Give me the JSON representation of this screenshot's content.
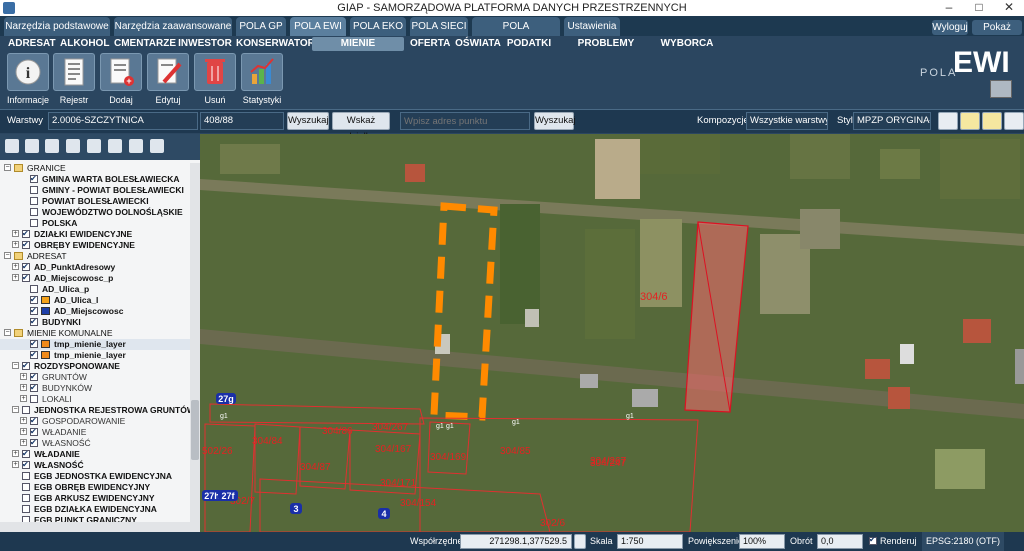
{
  "window": {
    "title": "GIAP - SAMORZĄDOWA PLATFORMA DANYCH PRZESTRZENNYCH",
    "minimize": "–",
    "maximize": "□",
    "close": "✕"
  },
  "tabs1": [
    "Narzędzia podstawowe",
    "Narzędzia zaawansowane",
    "POLA GP",
    "POLA EWI",
    "POLA EKO",
    "POLA SIECI",
    "POLA INTEGRACJE",
    "Ustawienia"
  ],
  "top_right": {
    "logout": "Wyloguj",
    "show_more": "Pokaż mniej"
  },
  "tabs2": [
    "ADRESAT",
    "ALKOHOL",
    "CMENTARZE",
    "INWESTOR",
    "KONSERWATOR",
    "MIENIE KOMUNALNE",
    "OFERTA",
    "OŚWIATA",
    "PODATKI",
    "PROBLEMY SPOŁECZNE",
    "WYBORCA"
  ],
  "ribbon": [
    "Informacje",
    "Rejestr",
    "Dodaj",
    "Edytuj",
    "Usuń",
    "Statystyki"
  ],
  "logo": {
    "pola": "POLA",
    "ewi": "EWI"
  },
  "toolbar": {
    "layers_label": "Warstwy",
    "obreb": "2.0006-SZCZYTNICA",
    "dzialka": "408/88",
    "search1": "Wyszukaj",
    "show_parcel": "Wskaż działkę",
    "addr_placeholder": "Wpisz adres punktu",
    "search2": "Wyszukaj",
    "comp_label": "Kompozycje:",
    "comp_value": "Wszystkie warstwy",
    "style_label": "Styl:",
    "style_value": "MPZP ORYGINAŁ"
  },
  "tree": [
    {
      "label": "GRANICE",
      "lvl": 0,
      "exp": "−",
      "bold": false
    },
    {
      "label": "GMINA WARTA BOLESŁAWIECKA",
      "lvl": 2,
      "chk": true,
      "bold": true
    },
    {
      "label": "GMINY - POWIAT BOLESŁAWIECKI",
      "lvl": 2,
      "chk": false,
      "bold": true
    },
    {
      "label": "POWIAT BOLESŁAWIECKI",
      "lvl": 2,
      "chk": false,
      "bold": true
    },
    {
      "label": "WOJEWÓDZTWO DOLNOŚLĄSKIE",
      "lvl": 2,
      "chk": false,
      "bold": true
    },
    {
      "label": "POLSKA",
      "lvl": 2,
      "chk": false,
      "bold": true
    },
    {
      "label": "DZIAŁKI EWIDENCYJNE",
      "lvl": 1,
      "chk": true,
      "bold": true,
      "exp": "+"
    },
    {
      "label": "OBRĘBY EWIDENCYJNE",
      "lvl": 1,
      "chk": true,
      "bold": true,
      "exp": "+"
    },
    {
      "label": "ADRESAT",
      "lvl": 0,
      "exp": "−",
      "bold": false
    },
    {
      "label": "AD_PunktAdresowy",
      "lvl": 1,
      "chk": true,
      "bold": true,
      "exp": "+"
    },
    {
      "label": "AD_Miejscowosc_p",
      "lvl": 1,
      "chk": true,
      "bold": true,
      "exp": "+"
    },
    {
      "label": "AD_Ulica_p",
      "lvl": 2,
      "chk": false,
      "bold": true
    },
    {
      "label": "AD_Ulica_l",
      "lvl": 2,
      "chk": true,
      "bold": true,
      "swatch": "#f4a21a"
    },
    {
      "label": "AD_Miejscowosc",
      "lvl": 2,
      "chk": true,
      "bold": true,
      "swatch": "#1e3fa8"
    },
    {
      "label": "BUDYNKI",
      "lvl": 2,
      "chk": true,
      "bold": true
    },
    {
      "label": "MIENIE KOMUNALNE",
      "lvl": 0,
      "exp": "−",
      "bold": false
    },
    {
      "label": "tmp_mienie_layer",
      "lvl": 2,
      "chk": true,
      "bold": true,
      "sel": true,
      "swatch": "#f08a1a"
    },
    {
      "label": "tmp_mienie_layer",
      "lvl": 2,
      "chk": true,
      "bold": true,
      "swatch": "#f08a1a"
    },
    {
      "label": "ROZDYSPONOWANE",
      "lvl": 1,
      "chk": true,
      "bold": true,
      "exp": "−"
    },
    {
      "label": "GRUNTÓW",
      "lvl": 2,
      "chk": true,
      "bold": false,
      "exp": "+"
    },
    {
      "label": "BUDYNKÓW",
      "lvl": 2,
      "chk": true,
      "bold": false,
      "exp": "+"
    },
    {
      "label": "LOKALI",
      "lvl": 2,
      "chk": false,
      "bold": false,
      "exp": "+"
    },
    {
      "label": "JEDNOSTKA REJESTROWA GRUNTÓW",
      "lvl": 1,
      "chk": false,
      "bold": true,
      "exp": "−"
    },
    {
      "label": "GOSPODAROWANIE",
      "lvl": 2,
      "chk": true,
      "bold": false,
      "exp": "+"
    },
    {
      "label": "WŁADANIE",
      "lvl": 2,
      "chk": true,
      "bold": false,
      "exp": "+"
    },
    {
      "label": "WŁASNOŚĆ",
      "lvl": 2,
      "chk": true,
      "bold": false,
      "exp": "+"
    },
    {
      "label": "WŁADANIE",
      "lvl": 1,
      "chk": true,
      "bold": true,
      "exp": "+"
    },
    {
      "label": "WŁASNOŚĆ",
      "lvl": 1,
      "chk": true,
      "bold": true,
      "exp": "+"
    },
    {
      "label": "EGB JEDNOSTKA EWIDENCYJNA",
      "lvl": 1,
      "chk": false,
      "bold": true
    },
    {
      "label": "EGB OBRĘB EWIDENCYJNY",
      "lvl": 1,
      "chk": false,
      "bold": true
    },
    {
      "label": "EGB ARKUSZ EWIDENCYJNY",
      "lvl": 1,
      "chk": false,
      "bold": true
    },
    {
      "label": "EGB DZIAŁKA EWIDENCYJNA",
      "lvl": 1,
      "chk": false,
      "bold": true
    },
    {
      "label": "EGB PUNKT GRANICZNY",
      "lvl": 1,
      "chk": false,
      "bold": true
    }
  ],
  "map": {
    "parcel_labels": [
      "304/6",
      "304/267",
      "304/84",
      "304/87",
      "304/86",
      "304/85",
      "304/167",
      "304/169",
      "304/171",
      "304/267",
      "304/154",
      "304/247",
      "302/7",
      "502/26",
      "302/6"
    ],
    "address_badges": [
      "27g",
      "27h",
      "27f",
      "3",
      "4"
    ],
    "point_labels": [
      "g1",
      "g1",
      "g1",
      "g1",
      "g1"
    ]
  },
  "status": {
    "coords_label": "Współrzędne",
    "coords": "271298.1,377529.5",
    "scale_label": "Skala",
    "scale": "1:750",
    "zoom_label": "Powiększenie",
    "zoom": "100%",
    "rotation_label": "Obrót",
    "rotation": "0,0",
    "render_label": "Renderuj",
    "epsg": "EPSG:2180 (OTF)"
  }
}
